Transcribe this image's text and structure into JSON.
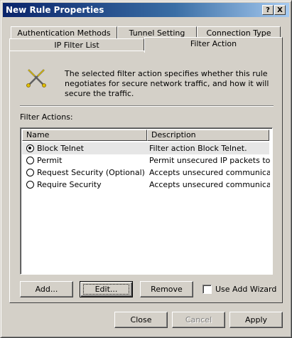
{
  "window": {
    "title": "New Rule Properties",
    "help_glyph": "?",
    "close_glyph": "X"
  },
  "tabs": {
    "back_row": [
      "Authentication Methods",
      "Tunnel Setting",
      "Connection Type"
    ],
    "front_row": [
      "IP Filter List",
      "Filter Action"
    ],
    "active": "Filter Action"
  },
  "panel": {
    "info_text": "The selected filter action specifies whether this rule negotiates for secure network traffic, and how it will secure the traffic.",
    "icon": "filter-action-icon",
    "list_label": "Filter Actions:",
    "columns": [
      "Name",
      "Description"
    ],
    "rows": [
      {
        "name": "Block Telnet",
        "description": "Filter action Block Telnet.",
        "selected": true
      },
      {
        "name": "Permit",
        "description": "Permit unsecured IP packets to ...",
        "selected": false
      },
      {
        "name": "Request Security (Optional)",
        "description": "Accepts unsecured communicat...",
        "selected": false
      },
      {
        "name": "Require Security",
        "description": "Accepts unsecured communicat...",
        "selected": false
      }
    ],
    "buttons": {
      "add": "Add...",
      "edit": "Edit...",
      "remove": "Remove"
    },
    "wizard_checkbox": {
      "label": "Use Add Wizard",
      "checked": false
    }
  },
  "footer": {
    "close": "Close",
    "cancel": "Cancel",
    "apply": "Apply"
  }
}
